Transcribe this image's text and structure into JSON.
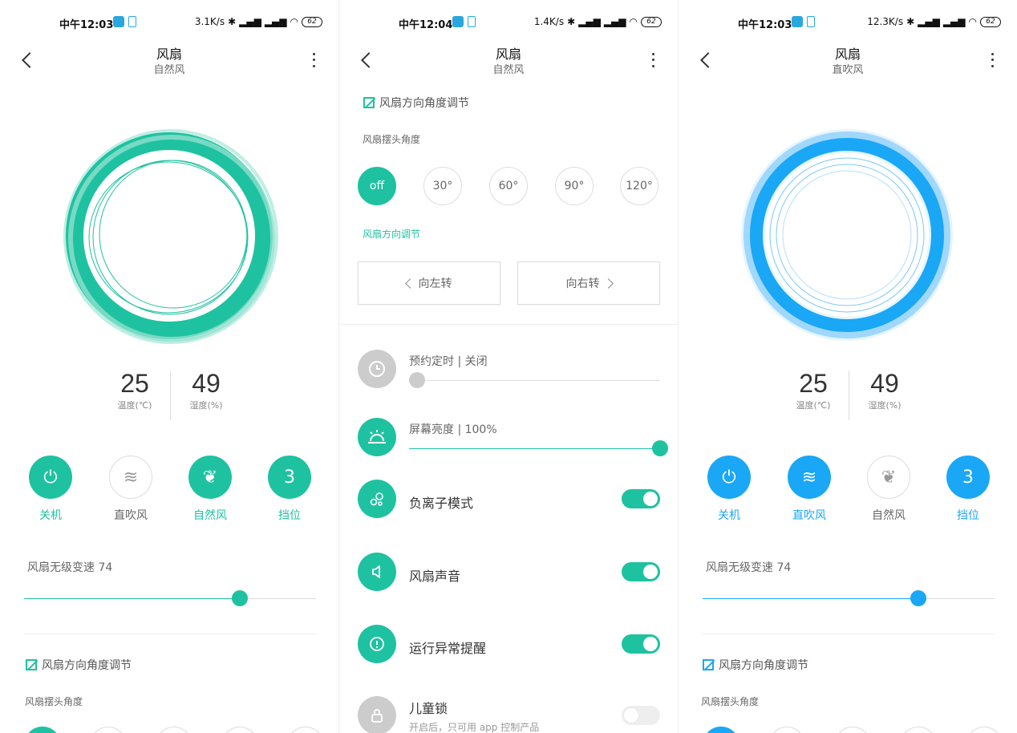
{
  "panel1": {
    "status": {
      "time": "中午12:03",
      "speed": "3.1K/s",
      "battery": "62"
    },
    "header": {
      "title": "风扇",
      "subtitle": "自然风"
    },
    "readings": {
      "temp": "25",
      "temp_label": "温度(℃)",
      "hum": "49",
      "hum_label": "湿度(%)"
    },
    "modes": [
      {
        "label": "关机",
        "active": true
      },
      {
        "label": "直吹风",
        "active": false
      },
      {
        "label": "自然风",
        "active": true
      },
      {
        "label": "挡位",
        "value": "3",
        "active": true
      }
    ],
    "speed_label": "风扇无级变速 74",
    "speed_value": 74,
    "section_title": "风扇方向角度调节",
    "swing_label": "风扇摆头角度"
  },
  "panel2": {
    "status": {
      "time": "中午12:04",
      "speed": "1.4K/s",
      "battery": "62"
    },
    "header": {
      "title": "风扇",
      "subtitle": "自然风"
    },
    "section_title": "风扇方向角度调节",
    "swing_label": "风扇摆头角度",
    "angles": [
      "off",
      "30°",
      "60°",
      "90°",
      "120°"
    ],
    "selected_angle": "off",
    "direction_label": "风扇方向调节",
    "turn_left": "向左转",
    "turn_right": "向右转",
    "settings": {
      "timer": "预约定时 | 关闭",
      "brightness": "屏幕亮度 | 100%",
      "anion": "负离子模式",
      "sound": "风扇声音",
      "alert": "运行异常提醒",
      "child_lock": "儿童锁",
      "child_lock_sub": "开启后，只可用 app 控制产品"
    },
    "toggles": {
      "anion": true,
      "sound": true,
      "alert": true,
      "child_lock": false
    }
  },
  "panel3": {
    "status": {
      "time": "中午12:03",
      "speed": "12.3K/s",
      "battery": "62"
    },
    "header": {
      "title": "风扇",
      "subtitle": "直吹风"
    },
    "readings": {
      "temp": "25",
      "temp_label": "温度(℃)",
      "hum": "49",
      "hum_label": "湿度(%)"
    },
    "modes": [
      {
        "label": "关机",
        "active": true
      },
      {
        "label": "直吹风",
        "active": true
      },
      {
        "label": "自然风",
        "active": false
      },
      {
        "label": "挡位",
        "value": "3",
        "active": true
      }
    ],
    "speed_label": "风扇无级变速 74",
    "speed_value": 74,
    "section_title": "风扇方向角度调节",
    "swing_label": "风扇摆头角度"
  },
  "colors": {
    "green": "#1ec2a1",
    "blue": "#1aa7f5"
  }
}
